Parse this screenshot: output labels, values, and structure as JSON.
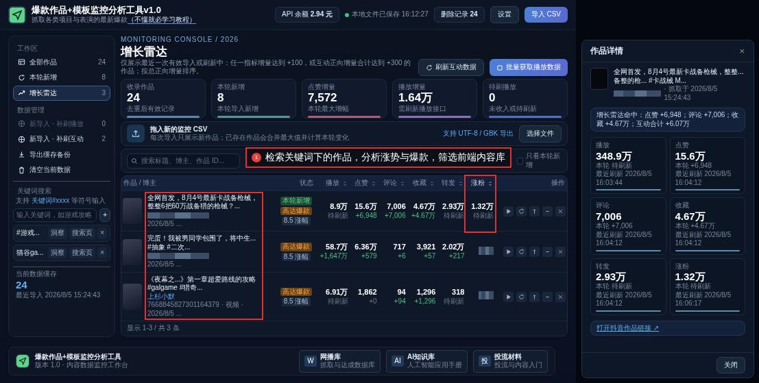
{
  "header": {
    "title": "爆款作品+模板监控分析工具v1.0",
    "subtitle": "抓取各类项目与表演的最新爆款",
    "subtitle_link": "（不懂就必学习教程）",
    "api_label": "API 余额",
    "api_value": "2.94 元",
    "save_status": "本地文件已保存 16:12:27",
    "delete_label": "删除记录",
    "delete_count": "24",
    "settings": "设置",
    "import": "导入 CSV"
  },
  "sidebar": {
    "sections": [
      {
        "heading": "工作区",
        "items": [
          {
            "label": "全部作品",
            "count": "24",
            "selected": false,
            "disabled": false
          },
          {
            "label": "本轮新增",
            "count": "8",
            "selected": false,
            "disabled": false
          },
          {
            "label": "增长雷达",
            "count": "3",
            "selected": true,
            "disabled": false
          }
        ]
      },
      {
        "heading": "数据管理",
        "items": [
          {
            "label": "新导入 · 补刷播放",
            "count": "0",
            "selected": false,
            "disabled": true
          },
          {
            "label": "新导入 · 补刷互动",
            "count": "2",
            "selected": false,
            "disabled": false
          },
          {
            "label": "导出缓存备份",
            "selected": false,
            "disabled": false
          },
          {
            "label": "清空当前数据",
            "selected": false,
            "disabled": false
          }
        ]
      }
    ],
    "keyword": {
      "heading": "关键词搜索",
      "hint_prefix": "支持 ",
      "hint_link": "关键词#xxxx",
      "hint_suffix": " 等符号输入",
      "placeholder": "输入关键词，如游戏攻略",
      "add": "+",
      "items": [
        {
          "label": "#游戏...",
          "actions": [
            "洞察",
            "搜索页"
          ],
          "remove": "×"
        },
        {
          "label": "猫谷ga...",
          "actions": [
            "洞察",
            "搜索页"
          ],
          "remove": "×"
        }
      ]
    },
    "cache": {
      "label": "当前数据缓存",
      "value": "24",
      "time": "最近导入 2026/8/5 15:24:43"
    }
  },
  "page": {
    "eyebrow": "MONITORING CONSOLE / 2026",
    "title": "增长雷达",
    "description": "仅展示最近一次有效导入或刷新中：任一指标增量达到 +100，或互动正向增量合计达到 +300 的作品；按总正向增量排序。",
    "buttons": [
      {
        "label": "刷新互动数据",
        "kind": "secondary"
      },
      {
        "label": "批量获取播放数据",
        "kind": "primary"
      }
    ]
  },
  "stats": [
    {
      "label": "收录作品",
      "value": "24",
      "note": "去重后有效记录",
      "color": "#5b86b0"
    },
    {
      "label": "本轮新增",
      "value": "8",
      "note": "本轮导入新增",
      "color": "#4f9a8c"
    },
    {
      "label": "点赞增量",
      "value": "7,572",
      "note": "本轮最大增幅",
      "color": "#b05b78"
    },
    {
      "label": "播放增量",
      "value": "1.64万",
      "note": "需刷新播放接口",
      "color": "#8b6fb8"
    },
    {
      "label": "待刷播放",
      "value": "0",
      "note": "未收入或待刷新",
      "color": "#4f72c4"
    }
  ],
  "upload": {
    "title": "拖入新的监控 CSV",
    "text": "每次导入只展示新作品；已存在作品会合并最大值并计算本轮变化",
    "encoding": "支持 UTF-8 / GBK 导出",
    "button": "选择文件"
  },
  "filters": {
    "search_placeholder": "搜索标题、博主、作品 ID...",
    "only_new": {
      "label": "只看本轮新增",
      "checked": false
    }
  },
  "annotation": {
    "number": "1",
    "text": "检索关键词下的作品，分析涨势与爆款，筛选前端内容库"
  },
  "table": {
    "date_highlighted": true,
    "columns": [
      {
        "label": "作品 / 博主",
        "sortable": false,
        "highlighted": false
      },
      {
        "label": "状态",
        "sortable": false,
        "highlighted": false
      },
      {
        "label": "播放",
        "sortable": true,
        "highlighted": false
      },
      {
        "label": "点赞",
        "sortable": true,
        "highlighted": false
      },
      {
        "label": "评论",
        "sortable": true,
        "highlighted": false
      },
      {
        "label": "收藏",
        "sortable": true,
        "highlighted": false
      },
      {
        "label": "转发",
        "sortable": true,
        "highlighted": false
      },
      {
        "label": "涨粉",
        "sortable": true,
        "highlighted": true
      },
      {
        "label": "操作",
        "sortable": false,
        "highlighted": false
      }
    ],
    "rows": [
      {
        "title": "全网首发，8月4号最新卡战备枪械，整整6把60万战备猎的枪械？...",
        "meta": "2026/8/5 ...",
        "badges": [
          {
            "label": "本轮新增",
            "kind": "new"
          },
          {
            "label": "高达爆款",
            "kind": "hot"
          },
          {
            "label": "8.5 涨幅",
            "kind": "score"
          }
        ],
        "metrics": [
          {
            "value": "8.9万",
            "note": "待刷新",
            "kind": "pending"
          },
          {
            "value": "15.6万",
            "note": "+6,948",
            "kind": "gain"
          },
          {
            "value": "7,006",
            "note": "+7,006",
            "kind": "gain"
          },
          {
            "value": "4.67万",
            "note": "+4.67万",
            "kind": "gain"
          },
          {
            "value": "2.93万",
            "note": "待刷新",
            "kind": "pending"
          },
          {
            "value": "1.32万",
            "note": "待刷新",
            "kind": "pending"
          }
        ]
      },
      {
        "title": "完蛋！我被男同学包围了，将中生... #抽象 #二次...",
        "meta": "2026/8/5 ...",
        "badges": [
          {
            "label": "高达爆款",
            "kind": "hot"
          },
          {
            "label": "8.5 涨幅",
            "kind": "score"
          }
        ],
        "metrics": [
          {
            "value": "58.7万",
            "note": "+1,647万",
            "kind": "gain"
          },
          {
            "value": "6.36万",
            "note": "+579",
            "kind": "gain"
          },
          {
            "value": "717",
            "note": "+6",
            "kind": "gain"
          },
          {
            "value": "3,921",
            "note": "+57",
            "kind": "gain"
          },
          {
            "value": "2.02万",
            "note": "+217",
            "kind": "gain"
          },
          {
            "kind": "hidden"
          }
        ]
      },
      {
        "title": "《夜幕之...》第一章超爱路线的攻略#galgame #猎奇...",
        "author": "上杉小默",
        "meta": "7668845827301164379 · 视频 · 2026/8/5 ...",
        "badges": [
          {
            "label": "高达爆款",
            "kind": "hot"
          },
          {
            "label": "8.5 涨幅",
            "kind": "score"
          }
        ],
        "metrics": [
          {
            "value": "6.91万",
            "note": "待刷新",
            "kind": "pending"
          },
          {
            "value": "1,862",
            "note": "+0",
            "kind": "pending"
          },
          {
            "value": "94",
            "note": "+94",
            "kind": "gain"
          },
          {
            "value": "1,296",
            "note": "+1,296",
            "kind": "gain"
          },
          {
            "value": "318",
            "note": "待刷新",
            "kind": "pending"
          },
          {
            "kind": "hidden"
          }
        ]
      }
    ],
    "footer": "显示 1-3 / 共 3 条"
  },
  "footer": {
    "title": "爆款作品+模板监控分析工具",
    "subtitle": "版本 1.0 · 内容数据监控工作台",
    "links": [
      {
        "mark": "W",
        "title": "网播库",
        "text": "抓取与达成数据库"
      },
      {
        "mark": "AI",
        "title": "AI知识库",
        "text": "人工智能应用手册"
      },
      {
        "mark": "投",
        "title": "投流材料",
        "text": "投流与内容入门"
      }
    ]
  },
  "modal": {
    "title": "作品详情",
    "close": "×",
    "work_title": "全网首发，8月4号最新卡战备枪械，整整... 备整的枪... #卡战械 M...",
    "work_meta": "· 抓取于 2026/8/5 15:24:43",
    "growth": "增长雷达命中：点赞 +6,948；评论 +7,006；收藏 +4.67万；互动合计 +6.07万",
    "metrics": [
      {
        "label": "播放",
        "value": "348.9万",
        "delta": "本轮 待刷新",
        "time": "最近刷新 2026/8/5 16:03:44"
      },
      {
        "label": "点赞",
        "value": "15.6万",
        "delta": "本轮 +6,948",
        "time": "最近刷新 2026/8/5 16:04:12"
      },
      {
        "label": "评论",
        "value": "7,006",
        "delta": "本轮 +7,006",
        "time": "最近刷新 2026/8/5 16:04:12"
      },
      {
        "label": "收藏",
        "value": "4.67万",
        "delta": "本轮 +4.67万",
        "time": "最近刷新 2026/8/5 16:04:12"
      },
      {
        "label": "转发",
        "value": "2.93万",
        "delta": "本轮 待刷新",
        "time": "最近刷新 2026/8/5 16:04:12"
      },
      {
        "label": "涨粉",
        "value": "1.32万",
        "delta": "本轮 待刷新",
        "time": "最近刷新 2026/8/5 16:06:17"
      }
    ],
    "link": "打开抖音作品链接 ↗",
    "button": "关闭"
  }
}
